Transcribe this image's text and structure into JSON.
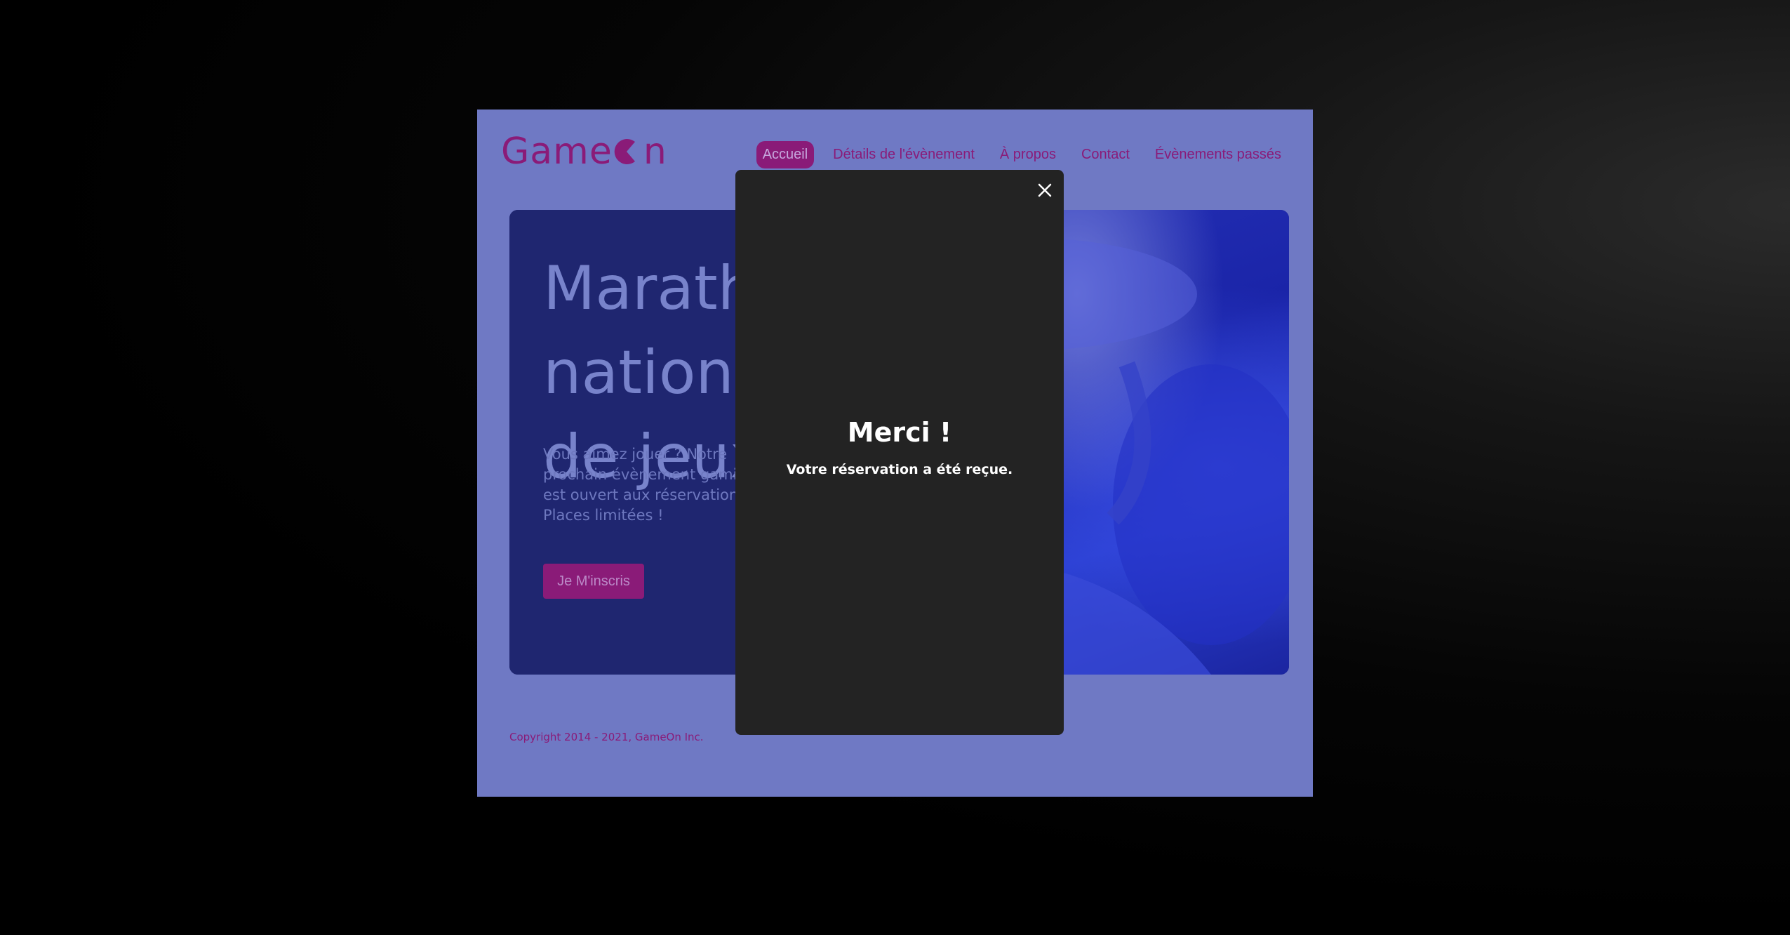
{
  "header": {
    "logo_text_before": "Game",
    "logo_text_after": "n",
    "nav": [
      {
        "label": "Accueil",
        "active": true
      },
      {
        "label": "Détails de l'évènement",
        "active": false
      },
      {
        "label": "À propos",
        "active": false
      },
      {
        "label": "Contact",
        "active": false
      },
      {
        "label": "Évènements passés",
        "active": false
      }
    ]
  },
  "hero": {
    "title_line1": "Marathon national",
    "title_line2": "de jeux vidéos",
    "text": "Vous aimez jouer ? Notre prochain évènement gaming est ouvert aux réservations... Places limitées !",
    "cta_label": "Je M'inscris"
  },
  "footer": {
    "copyright": "Copyright 2014 - 2021, GameOn Inc."
  },
  "modal": {
    "title": "Merci !",
    "message": "Votre réservation a été reçue."
  },
  "colors": {
    "brand": "#8a1b78",
    "overlay_page": "#6f79c4",
    "modal_bg": "#232323"
  }
}
